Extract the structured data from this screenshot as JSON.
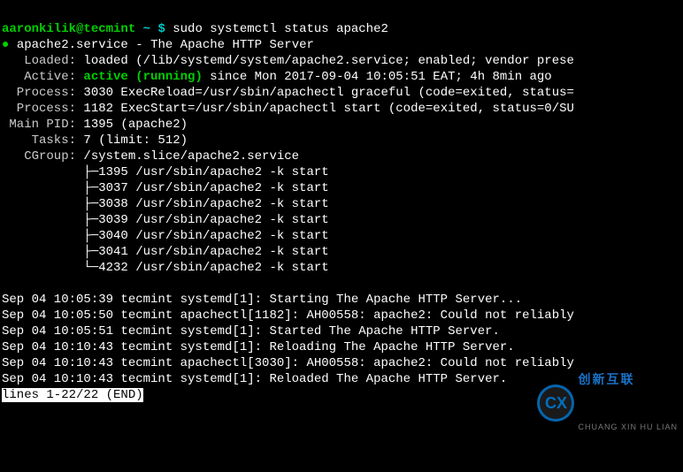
{
  "prompt": {
    "user": "aaronkilik@tecmint",
    "sep": " ~ $ ",
    "command": "sudo systemctl status apache2"
  },
  "status": {
    "dot": "●",
    "service_name": "apache2.service",
    "dash": " - ",
    "service_desc": "The Apache HTTP Server",
    "loaded_lbl": "   Loaded: ",
    "loaded_val": "loaded (/lib/systemd/system/apache2.service; enabled; vendor prese",
    "active_lbl": "   Active: ",
    "active_val": "active (running)",
    "active_since": " since Mon 2017-09-04 10:05:51 EAT; 4h 8min ago",
    "process1_lbl": "  Process: ",
    "process1_val": "3030 ExecReload=/usr/sbin/apachectl graceful (code=exited, status=",
    "process2_lbl": "  Process: ",
    "process2_val": "1182 ExecStart=/usr/sbin/apachectl start (code=exited, status=0/SU",
    "mainpid_lbl": " Main PID: ",
    "mainpid_val": "1395 (apache2)",
    "tasks_lbl": "    Tasks: ",
    "tasks_val": "7 (limit: 512)",
    "cgroup_lbl": "   CGroup: ",
    "cgroup_val": "/system.slice/apache2.service",
    "tree": [
      "           ├─1395 /usr/sbin/apache2 -k start",
      "           ├─3037 /usr/sbin/apache2 -k start",
      "           ├─3038 /usr/sbin/apache2 -k start",
      "           ├─3039 /usr/sbin/apache2 -k start",
      "           ├─3040 /usr/sbin/apache2 -k start",
      "           ├─3041 /usr/sbin/apache2 -k start",
      "           └─4232 /usr/sbin/apache2 -k start"
    ]
  },
  "log": [
    "Sep 04 10:05:39 tecmint systemd[1]: Starting The Apache HTTP Server...",
    "Sep 04 10:05:50 tecmint apachectl[1182]: AH00558: apache2: Could not reliably",
    "Sep 04 10:05:51 tecmint systemd[1]: Started The Apache HTTP Server.",
    "Sep 04 10:10:43 tecmint systemd[1]: Reloading The Apache HTTP Server.",
    "Sep 04 10:10:43 tecmint apachectl[3030]: AH00558: apache2: Could not reliably",
    "Sep 04 10:10:43 tecmint systemd[1]: Reloaded The Apache HTTP Server."
  ],
  "pager": "lines 1-22/22 (END)",
  "watermark": {
    "logo": "CX",
    "zh": "创新互联",
    "py": "CHUANG XIN HU LIAN"
  }
}
